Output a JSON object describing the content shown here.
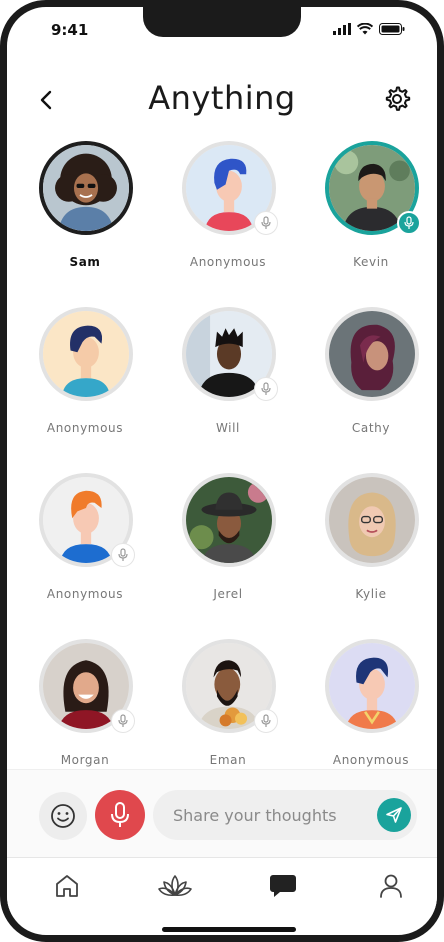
{
  "status_bar": {
    "time": "9:41"
  },
  "header": {
    "title": "Anything"
  },
  "participants": [
    {
      "name": "Sam",
      "type": "photo",
      "highlight": "dark",
      "mic": "none",
      "bold": true
    },
    {
      "name": "Anonymous",
      "type": "avatar",
      "mic": "muted"
    },
    {
      "name": "Kevin",
      "type": "photo",
      "highlight": "teal",
      "mic": "active"
    },
    {
      "name": "Anonymous",
      "type": "avatar",
      "mic": "none"
    },
    {
      "name": "Will",
      "type": "photo",
      "mic": "muted"
    },
    {
      "name": "Cathy",
      "type": "photo",
      "mic": "none"
    },
    {
      "name": "Anonymous",
      "type": "avatar",
      "mic": "muted"
    },
    {
      "name": "Jerel",
      "type": "photo",
      "mic": "none"
    },
    {
      "name": "Kylie",
      "type": "photo",
      "mic": "none"
    },
    {
      "name": "Morgan",
      "type": "photo",
      "mic": "muted"
    },
    {
      "name": "Eman",
      "type": "photo",
      "mic": "muted"
    },
    {
      "name": "Anonymous",
      "type": "avatar",
      "mic": "none"
    }
  ],
  "composer": {
    "placeholder": "Share your thoughts"
  },
  "tabs": [
    {
      "icon": "home-icon"
    },
    {
      "icon": "lotus-icon"
    },
    {
      "icon": "chat-bubble-icon"
    },
    {
      "icon": "profile-icon"
    }
  ],
  "colors": {
    "accent": "#1aa39c",
    "mic_red": "#e0484d"
  }
}
